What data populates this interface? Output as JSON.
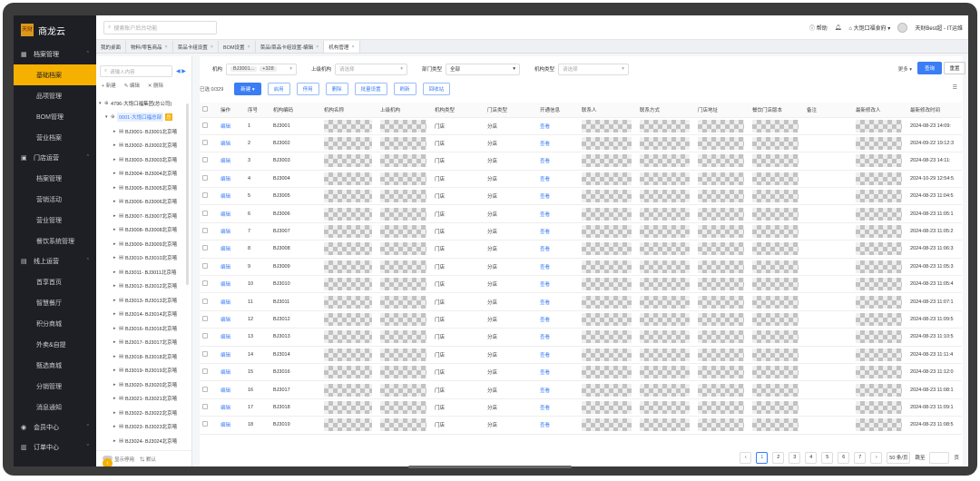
{
  "app": {
    "name": "商龙云",
    "logo_text": "天财商龙"
  },
  "sidebar": {
    "groups": [
      {
        "label": "档案管理",
        "items": [
          "基础档案",
          "品项管理",
          "BOM管理",
          "营业档案"
        ]
      },
      {
        "label": "门店运营",
        "items": [
          "档案管理",
          "营销活动",
          "营业管理",
          "餐饮系统管理"
        ]
      },
      {
        "label": "线上运营",
        "items": [
          "首享首页",
          "智慧餐厅",
          "积分商城",
          "外卖&自提",
          "甄选商城",
          "分销管理",
          "消息通知"
        ]
      },
      {
        "label": "会员中心",
        "items": []
      },
      {
        "label": "订单中心",
        "items": []
      }
    ],
    "active": "基础档案"
  },
  "topbar": {
    "search_placeholder": "搜索账户后台功能",
    "help": "帮助",
    "store": "大饱口福食府",
    "user": "天财Best超 - IT运维"
  },
  "tabs": [
    {
      "label": "我的桌面",
      "closable": false
    },
    {
      "label": "物料/零售商品",
      "closable": true
    },
    {
      "label": "菜品卡组设置",
      "closable": true
    },
    {
      "label": "BOM设置",
      "closable": true
    },
    {
      "label": "菜品/菜品卡组设置-编辑",
      "closable": true
    },
    {
      "label": "机构管理",
      "closable": true,
      "active": true
    }
  ],
  "tree": {
    "search_placeholder": "请输入内容",
    "actions": [
      "+ 新建",
      "✎ 编辑",
      "✕ 删除"
    ],
    "root": "4796-大饱口福集团(总公司)",
    "selected": "0001-大饱口福总部",
    "selected_badge": "总",
    "nodes": [
      "BJ3001- BJ3001北京嘻",
      "BJ3002- BJ3002北京嘻",
      "BJ3003- BJ3003北京嘻",
      "BJ3004- BJ3004北京嘻",
      "BJ3005- BJ3005北京嘻",
      "BJ3006- BJ3006北京嘻",
      "BJ3007- BJ3007北京嘻",
      "BJ3008- BJ3008北京嘻",
      "BJ3009- BJ3009北京嘻",
      "BJ3010- BJ3010北京嘻",
      "BJ3011- BJ3011北京嘻",
      "BJ3012- BJ3012北京嘻",
      "BJ3013- BJ3013北京嘻",
      "BJ3014- BJ3014北京嘻",
      "BJ3016- BJ3016北京嘻",
      "BJ3017- BJ3017北京嘻",
      "BJ3018- BJ3018北京嘻",
      "BJ3019- BJ3019北京嘻",
      "BJ3020- BJ3020北京嘻",
      "BJ3021- BJ3021北京嘻",
      "BJ3022- BJ3022北京嘻",
      "BJ3023- BJ3023北京嘻",
      "BJ3024- BJ3024北京嘻"
    ],
    "footer_toggle": "显示停用",
    "footer_default": "默认"
  },
  "filters": {
    "org_label": "机构",
    "org_chip": "BJ3001...",
    "org_more": "+328",
    "parent_label": "上级机构",
    "parent_placeholder": "请选择",
    "dept_type_label": "部门类型",
    "dept_type_value": "全部",
    "org_type_label": "机构类型",
    "org_type_placeholder": "请选择",
    "more": "更多",
    "query": "查询",
    "reset": "重置"
  },
  "toolbar": {
    "selected": "已选 0/329",
    "buttons": [
      "新建 ▾",
      "启用",
      "停用",
      "删除",
      "批量设置",
      "刷新",
      "回收站"
    ]
  },
  "table": {
    "headers": [
      "",
      "操作",
      "序号",
      "机构编码",
      "机构名称",
      "上级机构",
      "机构类型",
      "门店类型",
      "开通信息",
      "联系人",
      "联系方式",
      "门店地址",
      "餐饮门店版本",
      "备注",
      "最新修改人",
      "最新修改时间"
    ],
    "rows": [
      [
        "编辑",
        "1",
        "BJ3001",
        "门店",
        "分店",
        "查看",
        "2024-08-23 14:09:"
      ],
      [
        "编辑",
        "2",
        "BJ3002",
        "门店",
        "分店",
        "查看",
        "2024-09-22 19:12:3"
      ],
      [
        "编辑",
        "3",
        "BJ3003",
        "门店",
        "分店",
        "查看",
        "2024-08-23 14:11:"
      ],
      [
        "编辑",
        "4",
        "BJ3004",
        "门店",
        "分店",
        "查看",
        "2024-10-29 12:54:5"
      ],
      [
        "编辑",
        "5",
        "BJ3005",
        "门店",
        "分店",
        "查看",
        "2024-08-23 11:04:5"
      ],
      [
        "编辑",
        "6",
        "BJ3006",
        "门店",
        "分店",
        "查看",
        "2024-08-23 11:05:1"
      ],
      [
        "编辑",
        "7",
        "BJ3007",
        "门店",
        "分店",
        "查看",
        "2024-08-23 11:05:2"
      ],
      [
        "编辑",
        "8",
        "BJ3008",
        "门店",
        "分店",
        "查看",
        "2024-08-23 11:06:3"
      ],
      [
        "编辑",
        "9",
        "BJ3009",
        "门店",
        "分店",
        "查看",
        "2024-08-23 11:05:3"
      ],
      [
        "编辑",
        "10",
        "BJ3010",
        "门店",
        "分店",
        "查看",
        "2024-08-23 11:05:4"
      ],
      [
        "编辑",
        "11",
        "BJ3011",
        "门店",
        "分店",
        "查看",
        "2024-08-23 11:07:1"
      ],
      [
        "编辑",
        "12",
        "BJ3012",
        "门店",
        "分店",
        "查看",
        "2024-08-23 11:09:5"
      ],
      [
        "编辑",
        "13",
        "BJ3013",
        "门店",
        "分店",
        "查看",
        "2024-08-23 11:10:5"
      ],
      [
        "编辑",
        "14",
        "BJ3014",
        "门店",
        "分店",
        "查看",
        "2024-08-23 11:11:4"
      ],
      [
        "编辑",
        "15",
        "BJ3016",
        "门店",
        "分店",
        "查看",
        "2024-08-23 11:12:0"
      ],
      [
        "编辑",
        "16",
        "BJ3017",
        "门店",
        "分店",
        "查看",
        "2024-08-23 11:08:1"
      ],
      [
        "编辑",
        "17",
        "BJ3018",
        "门店",
        "分店",
        "查看",
        "2024-08-23 11:09:1"
      ],
      [
        "编辑",
        "18",
        "BJ3019",
        "门店",
        "分店",
        "查看",
        "2024-08-23 11:08:5"
      ]
    ]
  },
  "pager": {
    "pages": [
      "1",
      "2",
      "3",
      "4",
      "5",
      "6",
      "7"
    ],
    "active": "1",
    "page_size": "50 条/页",
    "goto": "跳至",
    "page_unit": "页"
  }
}
